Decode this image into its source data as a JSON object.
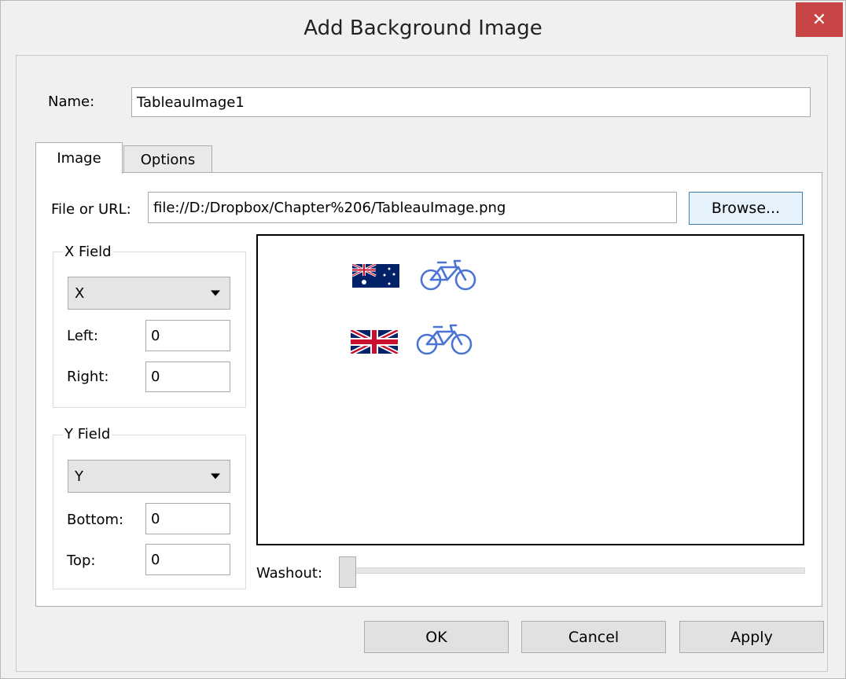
{
  "dialog": {
    "title": "Add Background Image",
    "close_glyph": "✕"
  },
  "name_field": {
    "label": "Name:",
    "value": "TableauImage1"
  },
  "tabs": [
    {
      "label": "Image",
      "active": true
    },
    {
      "label": "Options",
      "active": false
    }
  ],
  "image_tab": {
    "file_label": "File or URL:",
    "file_value": "file://D:/Dropbox/Chapter%206/TableauImage.png",
    "browse_label": "Browse...",
    "x_field": {
      "title": "X Field",
      "selected": "X",
      "left_label": "Left:",
      "left_value": "0",
      "right_label": "Right:",
      "right_value": "0"
    },
    "y_field": {
      "title": "Y Field",
      "selected": "Y",
      "bottom_label": "Bottom:",
      "bottom_value": "0",
      "top_label": "Top:",
      "top_value": "0"
    },
    "preview_icons": [
      "australia-flag-icon",
      "bicycle-icon",
      "uk-flag-icon",
      "bicycle-icon"
    ],
    "washout_label": "Washout:",
    "washout_value": 0
  },
  "buttons": {
    "ok": "OK",
    "cancel": "Cancel",
    "apply": "Apply"
  },
  "colors": {
    "close_button": "#c74545",
    "bicycle": "#4a74d6",
    "flag_navy": "#012169",
    "flag_red": "#c8102e"
  }
}
